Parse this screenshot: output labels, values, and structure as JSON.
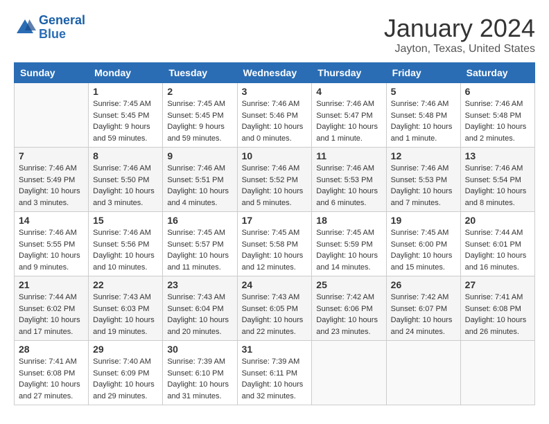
{
  "header": {
    "logo_line1": "General",
    "logo_line2": "Blue",
    "title": "January 2024",
    "subtitle": "Jayton, Texas, United States"
  },
  "columns": [
    "Sunday",
    "Monday",
    "Tuesday",
    "Wednesday",
    "Thursday",
    "Friday",
    "Saturday"
  ],
  "weeks": [
    [
      {
        "day": "",
        "info": ""
      },
      {
        "day": "1",
        "info": "Sunrise: 7:45 AM\nSunset: 5:45 PM\nDaylight: 9 hours\nand 59 minutes."
      },
      {
        "day": "2",
        "info": "Sunrise: 7:45 AM\nSunset: 5:45 PM\nDaylight: 9 hours\nand 59 minutes."
      },
      {
        "day": "3",
        "info": "Sunrise: 7:46 AM\nSunset: 5:46 PM\nDaylight: 10 hours\nand 0 minutes."
      },
      {
        "day": "4",
        "info": "Sunrise: 7:46 AM\nSunset: 5:47 PM\nDaylight: 10 hours\nand 1 minute."
      },
      {
        "day": "5",
        "info": "Sunrise: 7:46 AM\nSunset: 5:48 PM\nDaylight: 10 hours\nand 1 minute."
      },
      {
        "day": "6",
        "info": "Sunrise: 7:46 AM\nSunset: 5:48 PM\nDaylight: 10 hours\nand 2 minutes."
      }
    ],
    [
      {
        "day": "7",
        "info": "Sunrise: 7:46 AM\nSunset: 5:49 PM\nDaylight: 10 hours\nand 3 minutes."
      },
      {
        "day": "8",
        "info": "Sunrise: 7:46 AM\nSunset: 5:50 PM\nDaylight: 10 hours\nand 3 minutes."
      },
      {
        "day": "9",
        "info": "Sunrise: 7:46 AM\nSunset: 5:51 PM\nDaylight: 10 hours\nand 4 minutes."
      },
      {
        "day": "10",
        "info": "Sunrise: 7:46 AM\nSunset: 5:52 PM\nDaylight: 10 hours\nand 5 minutes."
      },
      {
        "day": "11",
        "info": "Sunrise: 7:46 AM\nSunset: 5:53 PM\nDaylight: 10 hours\nand 6 minutes."
      },
      {
        "day": "12",
        "info": "Sunrise: 7:46 AM\nSunset: 5:53 PM\nDaylight: 10 hours\nand 7 minutes."
      },
      {
        "day": "13",
        "info": "Sunrise: 7:46 AM\nSunset: 5:54 PM\nDaylight: 10 hours\nand 8 minutes."
      }
    ],
    [
      {
        "day": "14",
        "info": "Sunrise: 7:46 AM\nSunset: 5:55 PM\nDaylight: 10 hours\nand 9 minutes."
      },
      {
        "day": "15",
        "info": "Sunrise: 7:46 AM\nSunset: 5:56 PM\nDaylight: 10 hours\nand 10 minutes."
      },
      {
        "day": "16",
        "info": "Sunrise: 7:45 AM\nSunset: 5:57 PM\nDaylight: 10 hours\nand 11 minutes."
      },
      {
        "day": "17",
        "info": "Sunrise: 7:45 AM\nSunset: 5:58 PM\nDaylight: 10 hours\nand 12 minutes."
      },
      {
        "day": "18",
        "info": "Sunrise: 7:45 AM\nSunset: 5:59 PM\nDaylight: 10 hours\nand 14 minutes."
      },
      {
        "day": "19",
        "info": "Sunrise: 7:45 AM\nSunset: 6:00 PM\nDaylight: 10 hours\nand 15 minutes."
      },
      {
        "day": "20",
        "info": "Sunrise: 7:44 AM\nSunset: 6:01 PM\nDaylight: 10 hours\nand 16 minutes."
      }
    ],
    [
      {
        "day": "21",
        "info": "Sunrise: 7:44 AM\nSunset: 6:02 PM\nDaylight: 10 hours\nand 17 minutes."
      },
      {
        "day": "22",
        "info": "Sunrise: 7:43 AM\nSunset: 6:03 PM\nDaylight: 10 hours\nand 19 minutes."
      },
      {
        "day": "23",
        "info": "Sunrise: 7:43 AM\nSunset: 6:04 PM\nDaylight: 10 hours\nand 20 minutes."
      },
      {
        "day": "24",
        "info": "Sunrise: 7:43 AM\nSunset: 6:05 PM\nDaylight: 10 hours\nand 22 minutes."
      },
      {
        "day": "25",
        "info": "Sunrise: 7:42 AM\nSunset: 6:06 PM\nDaylight: 10 hours\nand 23 minutes."
      },
      {
        "day": "26",
        "info": "Sunrise: 7:42 AM\nSunset: 6:07 PM\nDaylight: 10 hours\nand 24 minutes."
      },
      {
        "day": "27",
        "info": "Sunrise: 7:41 AM\nSunset: 6:08 PM\nDaylight: 10 hours\nand 26 minutes."
      }
    ],
    [
      {
        "day": "28",
        "info": "Sunrise: 7:41 AM\nSunset: 6:08 PM\nDaylight: 10 hours\nand 27 minutes."
      },
      {
        "day": "29",
        "info": "Sunrise: 7:40 AM\nSunset: 6:09 PM\nDaylight: 10 hours\nand 29 minutes."
      },
      {
        "day": "30",
        "info": "Sunrise: 7:39 AM\nSunset: 6:10 PM\nDaylight: 10 hours\nand 31 minutes."
      },
      {
        "day": "31",
        "info": "Sunrise: 7:39 AM\nSunset: 6:11 PM\nDaylight: 10 hours\nand 32 minutes."
      },
      {
        "day": "",
        "info": ""
      },
      {
        "day": "",
        "info": ""
      },
      {
        "day": "",
        "info": ""
      }
    ]
  ]
}
